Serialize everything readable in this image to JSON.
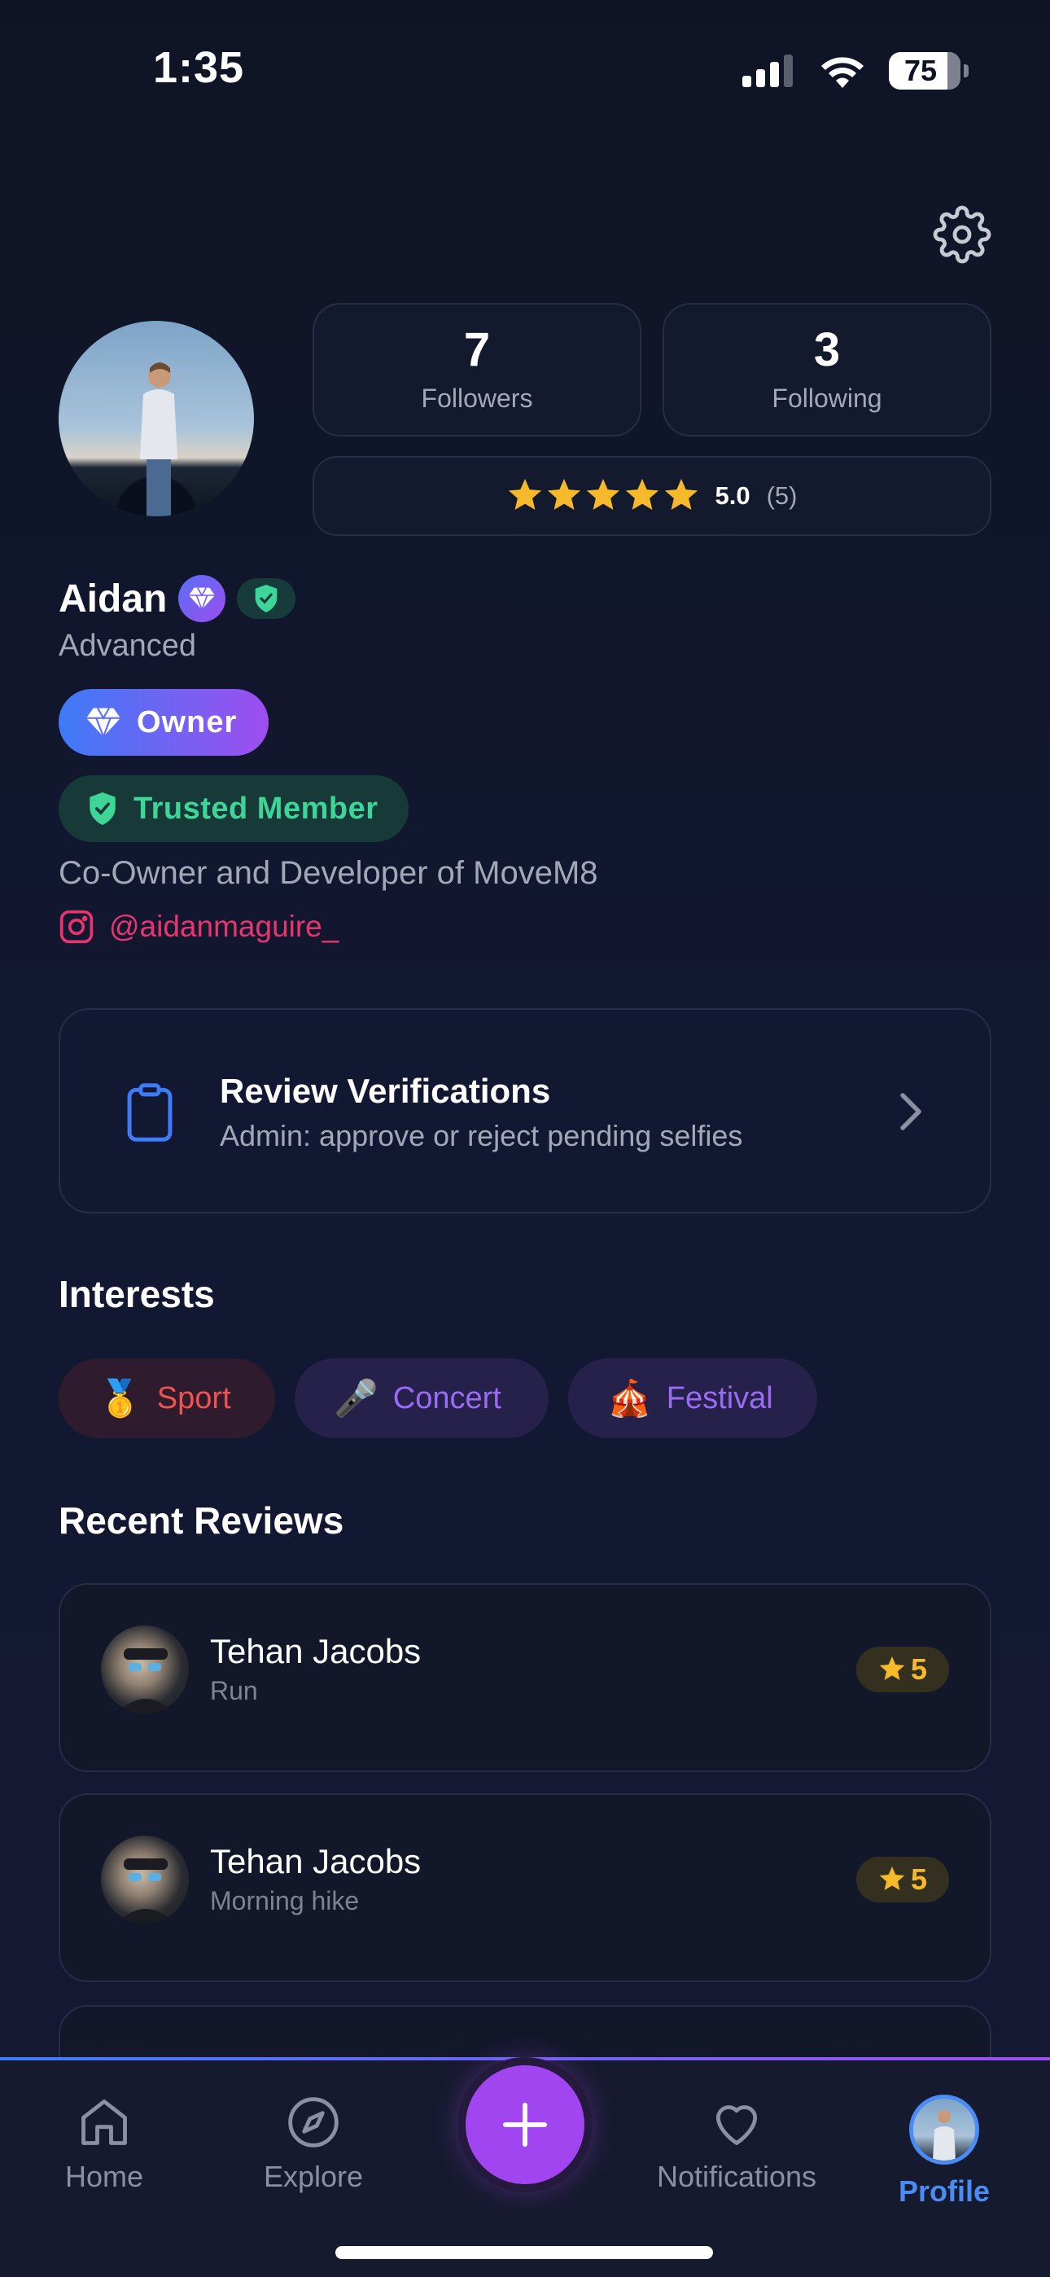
{
  "status_bar": {
    "time": "1:35",
    "battery": "75"
  },
  "profile": {
    "name": "Aidan",
    "level": "Advanced",
    "followers": {
      "count": "7",
      "label": "Followers"
    },
    "following": {
      "count": "3",
      "label": "Following"
    },
    "rating": {
      "value": "5.0",
      "count": "(5)",
      "stars": 5
    },
    "owner_badge": "Owner",
    "trusted_badge": "Trusted Member",
    "bio": "Co-Owner and Developer of MoveM8",
    "instagram": "@aidanmaguire_"
  },
  "verify_card": {
    "title": "Review Verifications",
    "subtitle": "Admin: approve or reject pending selfies"
  },
  "interests": {
    "title": "Interests",
    "items": [
      {
        "emoji": "🥇",
        "label": "Sport",
        "color": "#f0524f"
      },
      {
        "emoji": "🎤",
        "label": "Concert",
        "color": "#9a6cf5"
      },
      {
        "emoji": "🎪",
        "label": "Festival",
        "color": "#9a6cf5"
      }
    ]
  },
  "reviews": {
    "title": "Recent Reviews",
    "items": [
      {
        "name": "Tehan Jacobs",
        "activity": "Run",
        "rating": "5"
      },
      {
        "name": "Tehan Jacobs",
        "activity": "Morning hike",
        "rating": "5"
      }
    ]
  },
  "tabbar": {
    "home": "Home",
    "explore": "Explore",
    "notifications": "Notifications",
    "profile": "Profile"
  },
  "colors": {
    "accent_blue": "#4a8cf5",
    "accent_purple": "#a145f0",
    "trusted_green": "#3ed598",
    "star_gold": "#f5b92a",
    "instagram_pink": "#e8356f"
  }
}
